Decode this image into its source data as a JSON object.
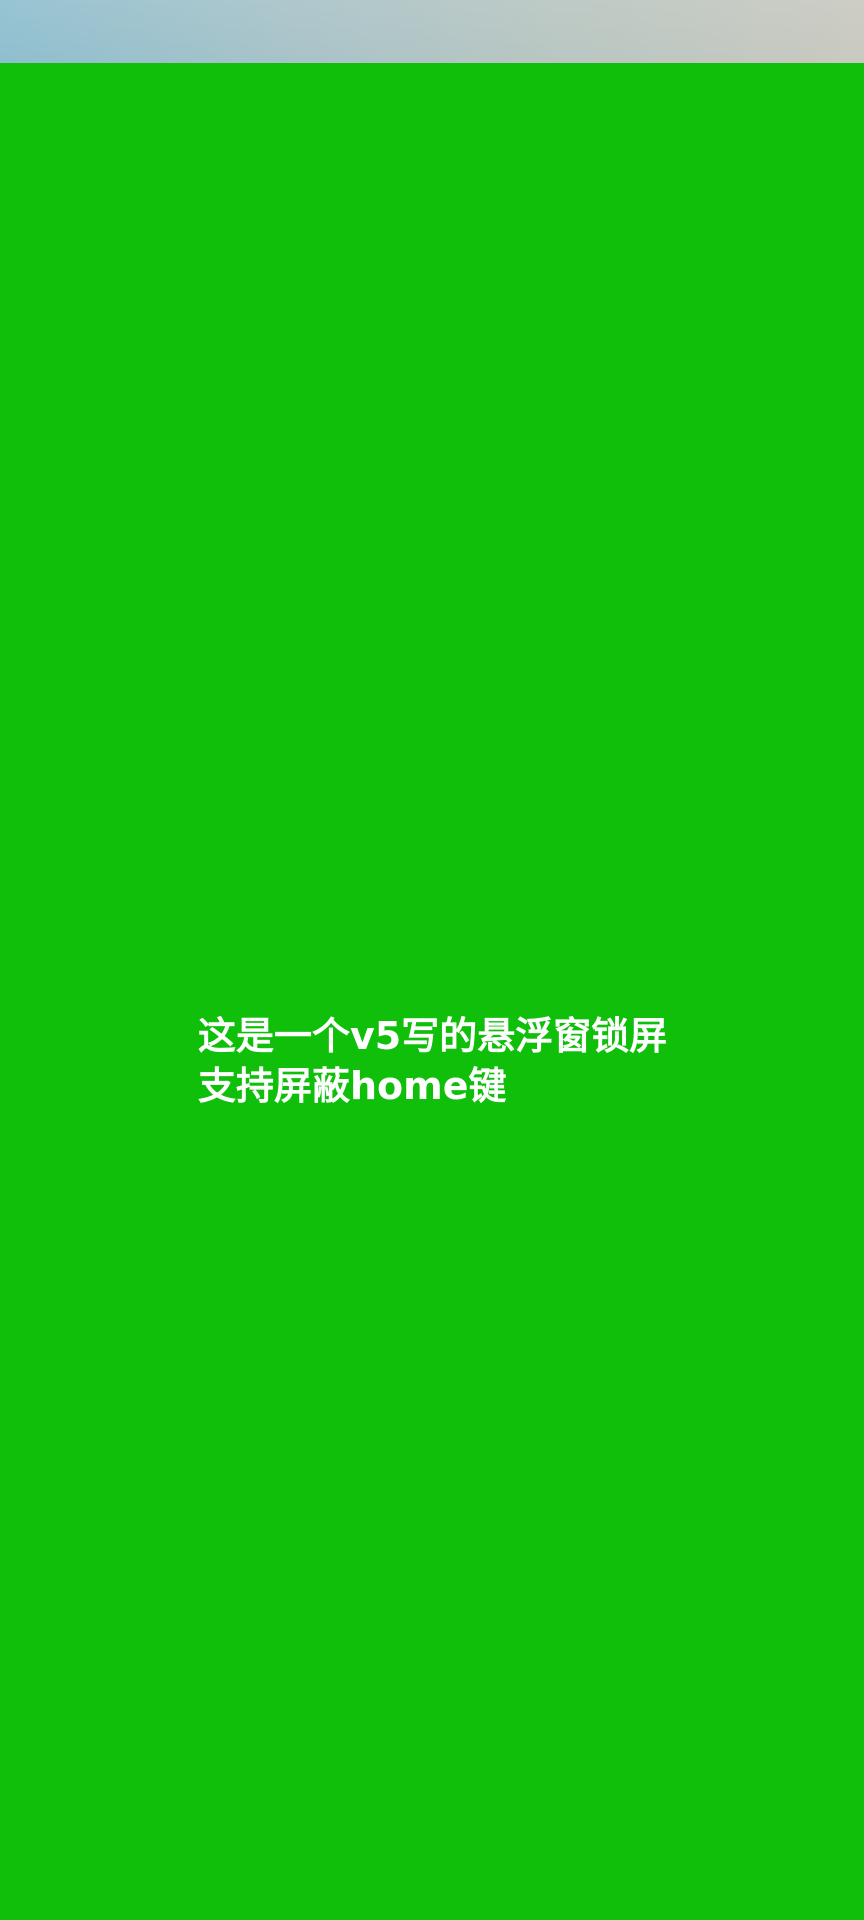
{
  "overlay": {
    "background_color": "#0fbf0a",
    "text_color": "#ffffff",
    "message_lines": [
      "这是一个v5写的悬浮窗锁屏",
      "支持屏蔽home键"
    ]
  },
  "status_bar": {
    "style": "blurred wallpaper strip"
  }
}
